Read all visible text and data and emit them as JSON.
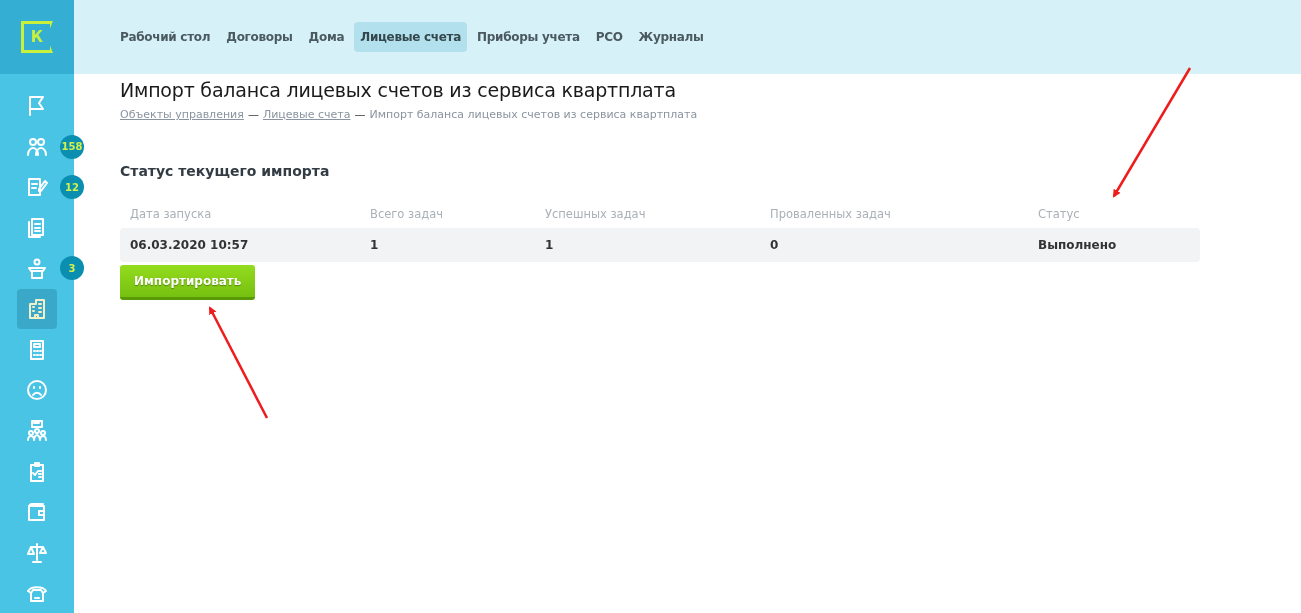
{
  "nav": [
    {
      "label": "Рабочий стол",
      "selected": false
    },
    {
      "label": "Договоры",
      "selected": false
    },
    {
      "label": "Дома",
      "selected": false
    },
    {
      "label": "Лицевые счета",
      "selected": true
    },
    {
      "label": "Приборы учета",
      "selected": false
    },
    {
      "label": "РСО",
      "selected": false
    },
    {
      "label": "Журналы",
      "selected": false
    }
  ],
  "logo": {
    "letter": "К"
  },
  "sidebar": {
    "items": [
      {
        "selected": false
      },
      {
        "selected": false,
        "badge": "158"
      },
      {
        "selected": false,
        "badge": "12"
      },
      {
        "selected": false
      },
      {
        "selected": false,
        "badge": "3"
      },
      {
        "selected": true
      },
      {
        "selected": false
      },
      {
        "selected": false
      },
      {
        "selected": false
      },
      {
        "selected": false
      },
      {
        "selected": false
      },
      {
        "selected": false
      },
      {
        "selected": false
      }
    ]
  },
  "page": {
    "title": "Импорт баланса лицевых счетов из сервиса квартплата",
    "breadcrumbs": [
      {
        "label": "Объекты управления",
        "link": true
      },
      {
        "label": "Лицевые счета",
        "link": true
      },
      {
        "label": "Импорт баланса лицевых счетов из сервиса квартплата",
        "link": false
      }
    ],
    "separator": "—",
    "section_title": "Статус текущего импорта",
    "table": {
      "columns": [
        "Дата запуска",
        "Всего задач",
        "Успешных задач",
        "Проваленных задач",
        "Статус"
      ],
      "rows": [
        [
          "06.03.2020 10:57",
          "1",
          "1",
          "0",
          "Выполнено"
        ]
      ]
    },
    "button": "Импортировать"
  }
}
